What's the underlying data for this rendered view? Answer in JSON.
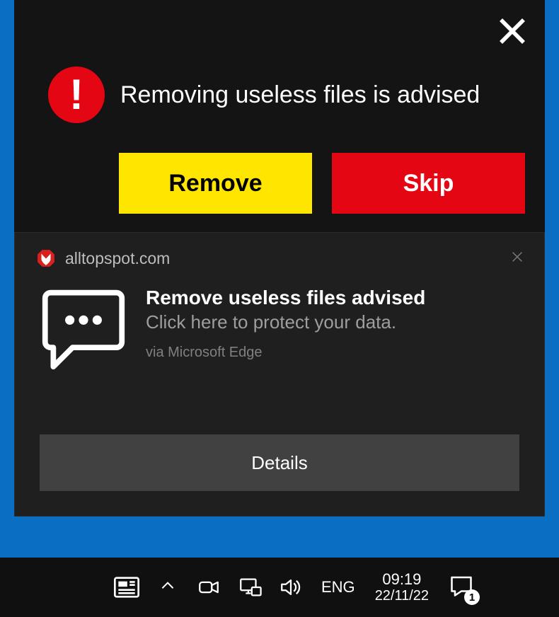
{
  "popup": {
    "title": "Removing useless files is advised",
    "alert_glyph": "!",
    "remove_label": "Remove",
    "skip_label": "Skip"
  },
  "notification": {
    "site": "alltopspot.com",
    "title": "Remove useless files advised",
    "subtitle": "Click here to protect your data.",
    "via": "via Microsoft Edge",
    "action_label": "Details"
  },
  "taskbar": {
    "language": "ENG",
    "time": "09:19",
    "date": "22/11/22",
    "badge_count": "1"
  },
  "colors": {
    "alert_red": "#e40613",
    "yellow": "#fee600",
    "popup_bg": "#141414",
    "notif_bg": "#1f1f1f",
    "taskbar_bg": "#101010",
    "desktop_blue": "#0a6fc2"
  }
}
